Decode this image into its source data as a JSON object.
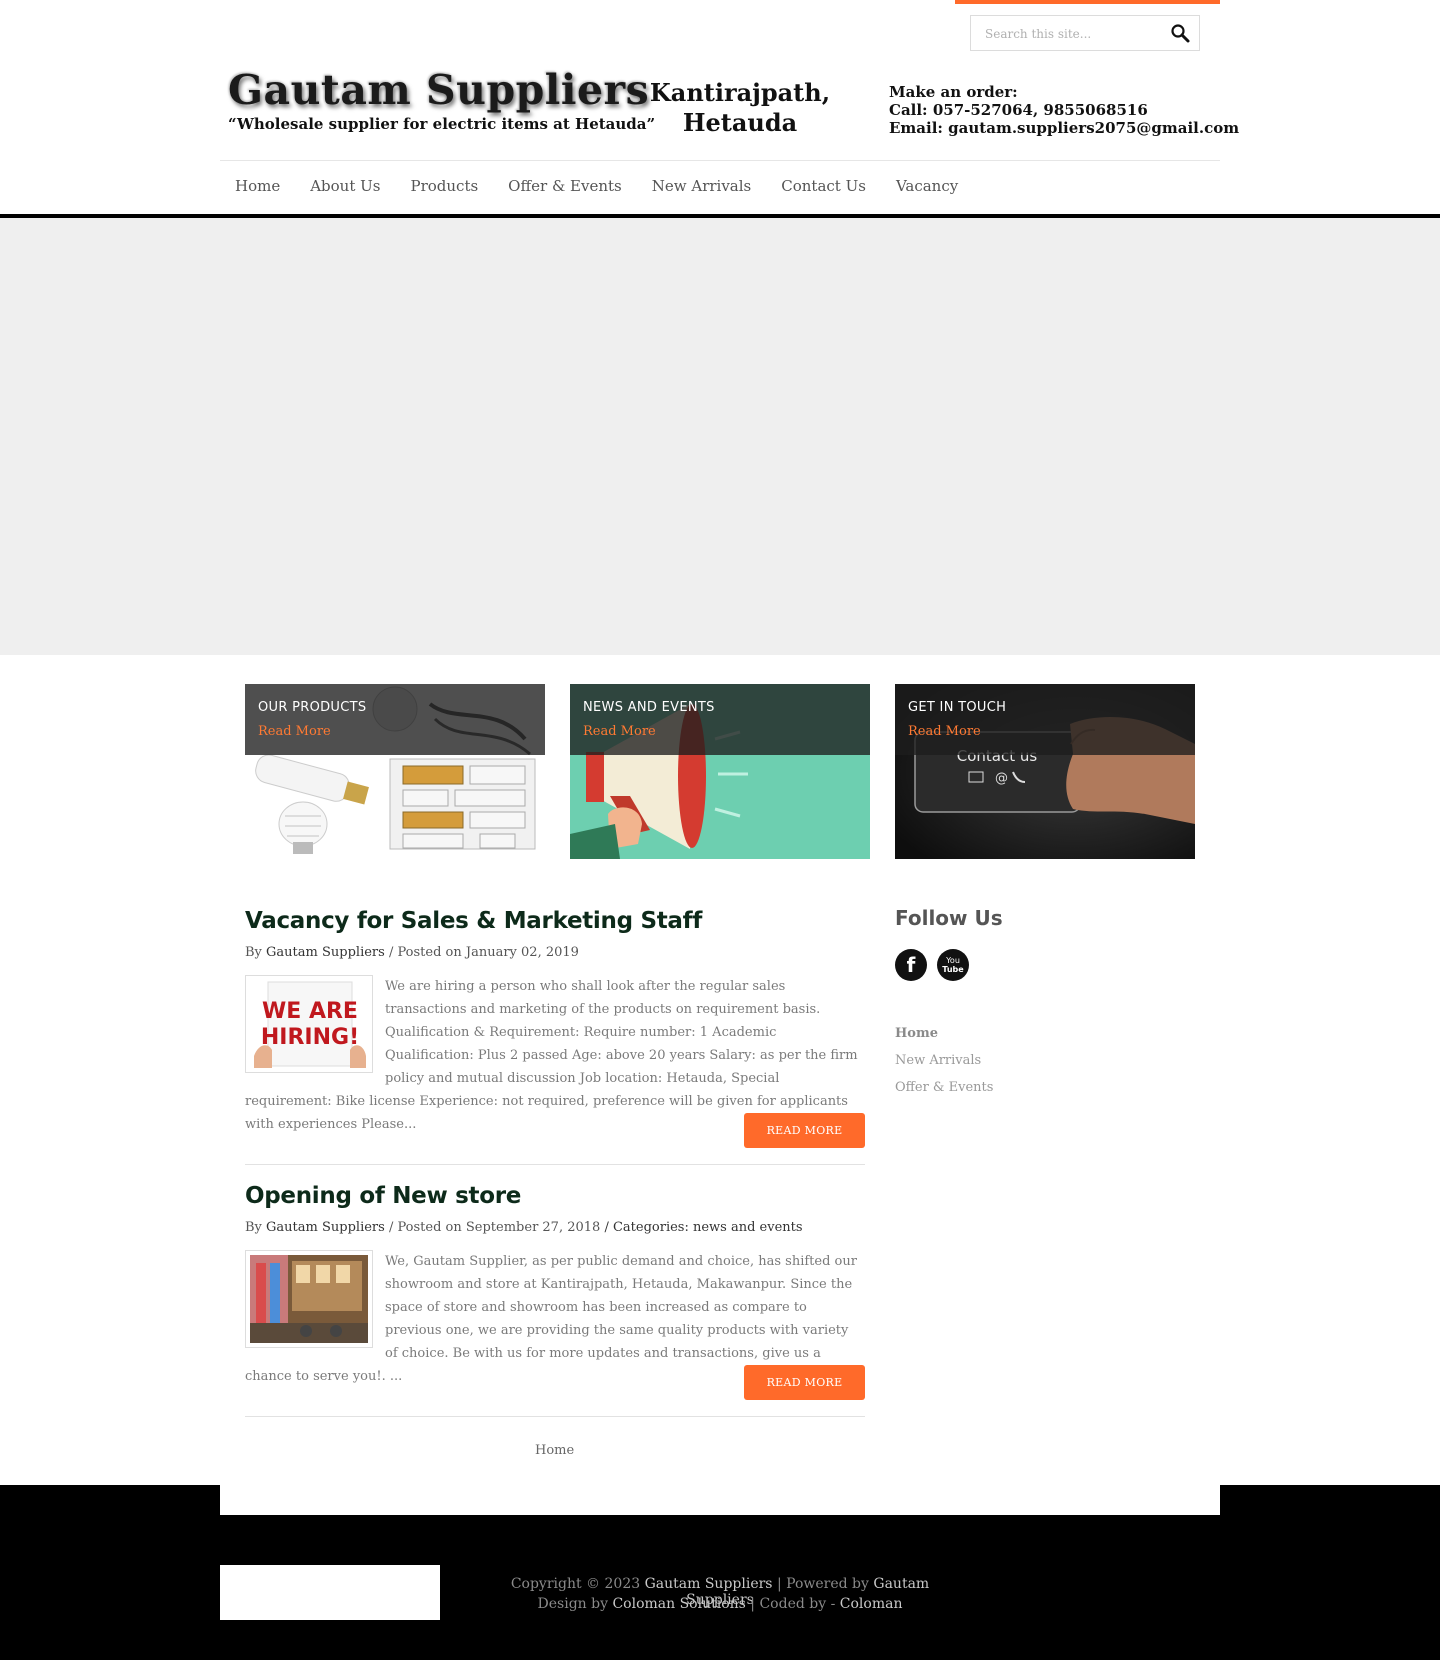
{
  "search": {
    "placeholder": "Search this site..."
  },
  "header": {
    "site_title": "Gautam Suppliers",
    "tagline": "“Wholesale supplier for electric items at Hetauda”",
    "location_line1": "Kantirajpath,",
    "location_line2": "Hetauda",
    "order_label": "Make an order:",
    "call": "Call: 057-527064, 9855068516",
    "email": "Email: gautam.suppliers2075@gmail.com"
  },
  "nav": [
    {
      "label": "Home"
    },
    {
      "label": "About Us"
    },
    {
      "label": "Products"
    },
    {
      "label": "Offer & Events"
    },
    {
      "label": "New Arrivals"
    },
    {
      "label": "Contact Us"
    },
    {
      "label": "Vacancy"
    }
  ],
  "features": [
    {
      "title": "OUR PRODUCTS",
      "link": "Read More"
    },
    {
      "title": "NEWS AND EVENTS",
      "link": "Read More"
    },
    {
      "title": "GET IN TOUCH",
      "link": "Read More"
    }
  ],
  "feature_image_text": {
    "hiring_line1": "WE ARE",
    "hiring_line2": "HIRING!",
    "contact": "Contact us"
  },
  "posts": [
    {
      "title": "Vacancy for Sales & Marketing Staff",
      "by": "By",
      "author": "Gautam Suppliers",
      "posted": "/ Posted on January 02, 2019",
      "categories": "",
      "excerpt": "We are hiring a person who shall look after the regular sales transactions and marketing of the products on requirement basis. Qualification & Requirement: Require number: 1 Academic Qualification: Plus 2 passed Age: above 20 years Salary: as per the firm policy and mutual discussion Job location: Hetauda, Special requirement: Bike license Experience: not required, preference will be given for applicants with experiences Please...",
      "read_more": "READ MORE"
    },
    {
      "title": "Opening of New store",
      "by": "By",
      "author": "Gautam Suppliers",
      "posted": "/ Posted on September 27, 2018",
      "categories": "/ Categories: news and events",
      "excerpt": "We, Gautam Supplier, as per public demand and choice, has shifted our showroom and store at Kantirajpath, Hetauda, Makawanpur. Since the space of store and showroom has been increased as compare to previous one, we are providing the same quality products with variety of choice. Be with us for more updates and transactions, give us a chance to serve you!. ...",
      "read_more": "READ MORE"
    }
  ],
  "pagination": {
    "home": "Home"
  },
  "sidebar": {
    "follow_title": "Follow Us",
    "social": [
      {
        "name": "facebook-icon",
        "glyph": "f"
      },
      {
        "name": "youtube-icon",
        "glyph_top": "You",
        "glyph_bottom": "Tube"
      }
    ],
    "links": [
      {
        "label": "Home"
      },
      {
        "label": "New Arrivals"
      },
      {
        "label": "Offer & Events"
      }
    ]
  },
  "footer": {
    "copyright_prefix": "Copyright © 2023",
    "copyright_name": "Gautam Suppliers",
    "powered_prefix": "| Powered by",
    "powered_name": "Gautam Suppliers",
    "design_prefix": "Design by",
    "design_name": "Coloman Solutions",
    "coded_prefix": "| Coded by -",
    "coded_name": "Coloman"
  },
  "colors": {
    "accent": "#ff6a2a",
    "heading": "#0d2a1a",
    "nav_bar": "#000000"
  }
}
